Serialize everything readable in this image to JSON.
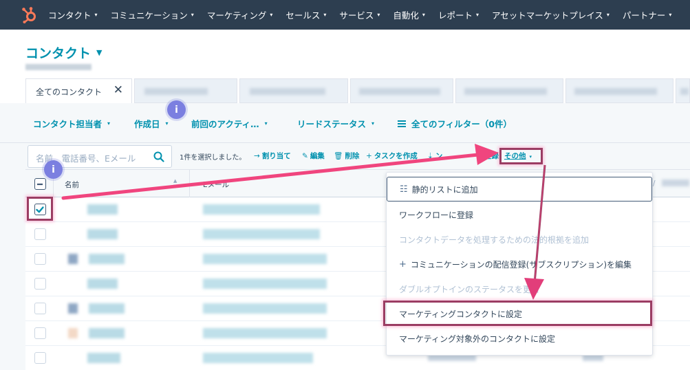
{
  "nav": {
    "items": [
      {
        "label": "コンタクト"
      },
      {
        "label": "コミュニケーション"
      },
      {
        "label": "マーケティング"
      },
      {
        "label": "セールス"
      },
      {
        "label": "サービス"
      },
      {
        "label": "自動化"
      },
      {
        "label": "レポート"
      },
      {
        "label": "アセットマーケットプレイス"
      },
      {
        "label": "パートナー"
      }
    ],
    "chevron": "▾",
    "logo_icon": "hubspot-sprocket-icon",
    "brand_color": "#ff7a59"
  },
  "page": {
    "title": "コンタクト",
    "title_caret": "▼"
  },
  "tabs": {
    "active_label": "全てのコンタクト",
    "close_glyph": "✕"
  },
  "filters": {
    "owner": "コンタクト担当者",
    "created": "作成日",
    "last_activity": "前回のアクティ…",
    "lead_status": "リードステータス",
    "all_filters": "全てのフィルター（0件）",
    "caret": "▾"
  },
  "toolbar": {
    "search_placeholder": "名前、電話番号、Eメール",
    "selected_text": "1件を選択しました。",
    "actions": {
      "assign": {
        "icon": "→",
        "label": "割り当て"
      },
      "edit": {
        "icon": "✎",
        "label": "編集"
      },
      "delete": {
        "icon": "🗑",
        "label": "削除"
      },
      "create_task": {
        "icon": "+",
        "label": "タスクを作成"
      },
      "partial_icon": "⇣",
      "partial_text": "ン",
      "partial_register": "登録"
    },
    "more_label": "その他",
    "more_caret": "▾"
  },
  "table": {
    "col_name": "名前",
    "col_email": "Eメール",
    "sort_glyph": "▲\n▼",
    "right_fragment": "/"
  },
  "dropdown": {
    "items": [
      {
        "icon": "☷",
        "label": "静的リストに追加"
      },
      {
        "label": "ワークフローに登録"
      },
      {
        "label": "コンタクトデータを処理するための法的根拠を追加"
      },
      {
        "icon": "+",
        "label": "コミュニケーションの配信登録(サブスクリプション)を編集"
      },
      {
        "label": "ダブルオプトインのステータスを更新"
      },
      {
        "label": "マーケティングコンタクトに設定"
      },
      {
        "label": "マーケティング対象外のコンタクトに設定"
      }
    ]
  },
  "annotations": {
    "badge_text": "i",
    "highlight_color": "#9b3d63",
    "arrow_color": "#f0457e",
    "badge_color": "#7b7fe0"
  }
}
